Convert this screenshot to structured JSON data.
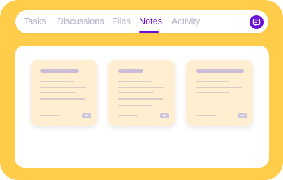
{
  "tabs": [
    {
      "label": "Tasks",
      "active": false
    },
    {
      "label": "Discussions",
      "active": false
    },
    {
      "label": "Files",
      "active": false
    },
    {
      "label": "Notes",
      "active": true
    },
    {
      "label": "Activity",
      "active": false
    }
  ],
  "notes_button": {
    "icon": "notes-icon"
  },
  "cards": [
    {
      "id": "note-1"
    },
    {
      "id": "note-2"
    },
    {
      "id": "note-3"
    }
  ],
  "colors": {
    "frame": "#FFCD4A",
    "accent": "#6A0EDC",
    "tab_inactive": "#B6B0C8",
    "card": "#FFEFD0"
  }
}
